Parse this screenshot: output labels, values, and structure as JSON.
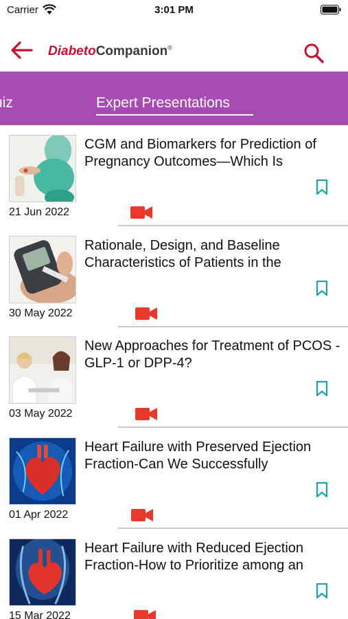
{
  "status_bar": {
    "carrier": "Carrier",
    "time": "3:01 PM"
  },
  "header": {
    "logo_part1": "Diabeto",
    "logo_part2": "Companion",
    "logo_mark": "®"
  },
  "tabs": [
    {
      "label": "uiz"
    },
    {
      "label": "Expert Presentations"
    }
  ],
  "colors": {
    "tab_bar": "#a84bb3",
    "brand_red": "#c8102e",
    "video_icon": "#e8392c",
    "bookmark": "#1aa3a8"
  },
  "icons": {
    "back": "arrow-left-icon",
    "search": "search-icon",
    "video": "video-camera-icon",
    "bookmark": "bookmark-icon"
  },
  "items": [
    {
      "title": "CGM and Biomarkers for Prediction of Pregnancy Outcomes—Which Is",
      "date": "21 Jun 2022",
      "image": "pregnant-woman-image"
    },
    {
      "title": "Rationale, Design, and Baseline Characteristics of Patients in the",
      "date": "30 May 2022",
      "image": "glucose-meter-image"
    },
    {
      "title": "New Approaches for Treatment of PCOS - GLP-1 or DPP-4?",
      "date": "03 May 2022",
      "image": "doctor-consultation-image"
    },
    {
      "title": "Heart Failure with Preserved Ejection Fraction-Can We Successfully",
      "date": "01 Apr 2022",
      "image": "heart-illustration-image"
    },
    {
      "title": "Heart Failure with Reduced Ejection Fraction-How to Prioritize among an",
      "date": "15 Mar 2022",
      "image": "heart-anatomy-image"
    }
  ]
}
